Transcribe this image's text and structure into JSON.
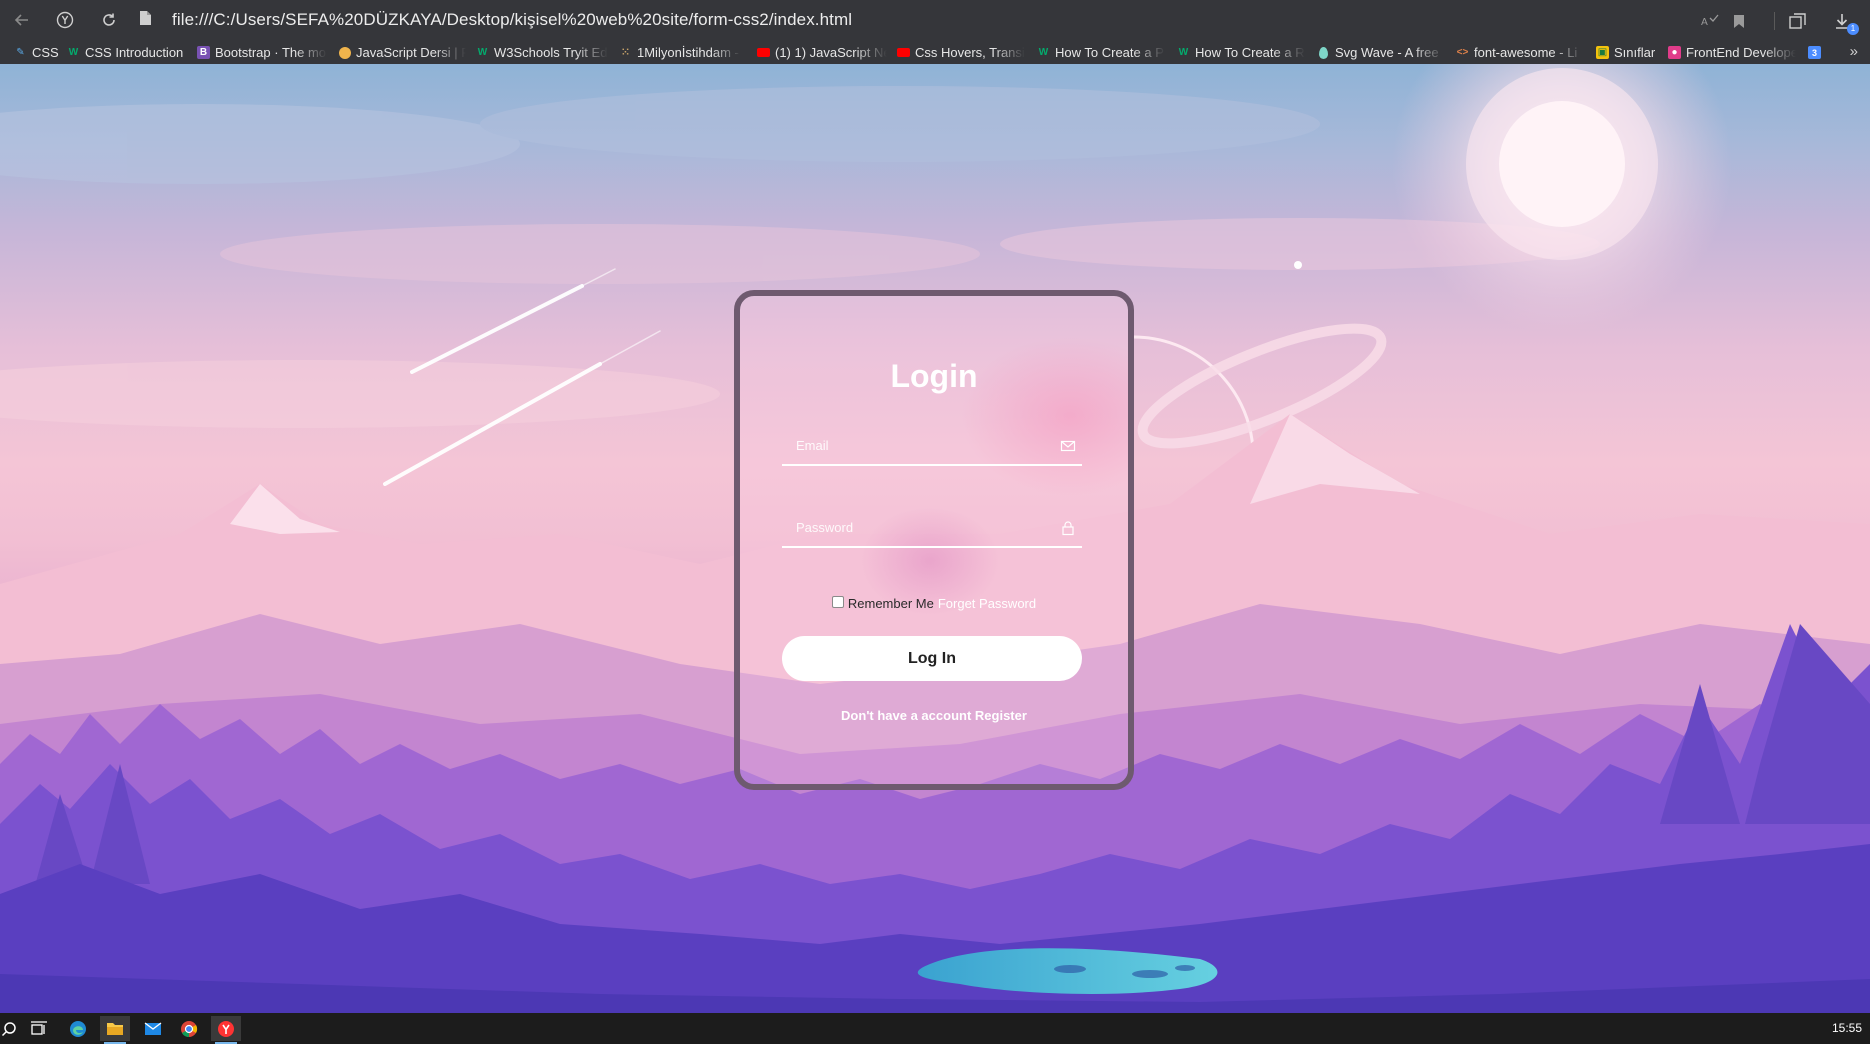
{
  "browser": {
    "url": "file:///C:/Users/SEFA%20DÜZKAYA/Desktop/kişisel%20web%20site/form-css2/index.html",
    "bookmarks": [
      {
        "label": "CSS",
        "icon": "css-bookmark-icon",
        "color": "#5aa9e6"
      },
      {
        "label": "CSS Introduction",
        "icon": "w3schools-icon",
        "color": "#04aa6d"
      },
      {
        "label": "Bootstrap · The mo",
        "icon": "bootstrap-icon",
        "color": "#7952b3"
      },
      {
        "label": "JavaScript Dersi | P",
        "icon": "circle-icon",
        "color": "#f0b44c"
      },
      {
        "label": "W3Schools Tryit Ed",
        "icon": "w3schools-icon",
        "color": "#04aa6d"
      },
      {
        "label": "1Milyonİstihdam -",
        "icon": "dots-icon",
        "color": "#c9a46a"
      },
      {
        "label": "(1) 1) JavaScript Ne",
        "icon": "youtube-icon",
        "color": "#ff0000"
      },
      {
        "label": "Css Hovers, Transit",
        "icon": "youtube-icon",
        "color": "#ff0000"
      },
      {
        "label": "How To Create a P",
        "icon": "w3schools-icon",
        "color": "#04aa6d"
      },
      {
        "label": "How To Create a R",
        "icon": "w3schools-icon",
        "color": "#04aa6d"
      },
      {
        "label": "Svg Wave - A free",
        "icon": "drop-icon",
        "color": "#7ed6c8"
      },
      {
        "label": "font-awesome - Li",
        "icon": "code-icon",
        "color": "#e0824a"
      },
      {
        "label": "Sınıflar",
        "icon": "classroom-icon",
        "color": "#f4c20d"
      },
      {
        "label": "FrontEnd Develope",
        "icon": "profile-icon",
        "color": "#e03c8a"
      },
      {
        "label": "",
        "icon": "calendar-icon",
        "color": "#4c8dff"
      }
    ],
    "download_badge": "1"
  },
  "login": {
    "title": "Login",
    "email_placeholder": "Email",
    "password_placeholder": "Password",
    "remember_label": "Remember Me",
    "forget_label": "Forget Password",
    "button_label": "Log In",
    "no_account_text": "Don't have a account",
    "register_label": "Register"
  },
  "taskbar": {
    "clock": "15:55"
  },
  "colors": {
    "card_border": "#6e5a6f",
    "button_bg": "#ffffff",
    "chrome_bg": "#35363a",
    "taskbar_bg": "#1c1c1c"
  }
}
